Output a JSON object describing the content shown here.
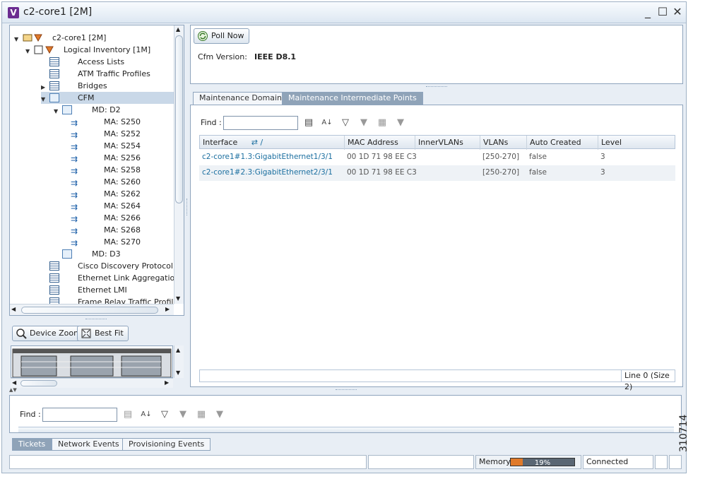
{
  "window": {
    "badge": "V",
    "title": "c2-core1 [2M]"
  },
  "tree": {
    "items": [
      {
        "label": "c2-core1 [2M]"
      },
      {
        "label": "Logical Inventory [1M]"
      },
      {
        "label": "Access Lists"
      },
      {
        "label": "ATM Traffic Profiles"
      },
      {
        "label": "Bridges"
      },
      {
        "label": "CFM"
      },
      {
        "label": "MD: D2"
      },
      {
        "label": "MA: S250"
      },
      {
        "label": "MA: S252"
      },
      {
        "label": "MA: S254"
      },
      {
        "label": "MA: S256"
      },
      {
        "label": "MA: S258"
      },
      {
        "label": "MA: S260"
      },
      {
        "label": "MA: S262"
      },
      {
        "label": "MA: S264"
      },
      {
        "label": "MA: S266"
      },
      {
        "label": "MA: S268"
      },
      {
        "label": "MA: S270"
      },
      {
        "label": "MD: D3"
      },
      {
        "label": "Cisco Discovery Protocol"
      },
      {
        "label": "Ethernet Link Aggregation"
      },
      {
        "label": "Ethernet LMI"
      },
      {
        "label": "Frame Relay Traffic Profiles"
      }
    ]
  },
  "zoom": {
    "device_zoom_label": "Device Zoom",
    "best_fit_label": "Best Fit"
  },
  "details": {
    "poll_now_label": "Poll Now",
    "cfm_version_label": "Cfm Version:",
    "cfm_version_value": "IEEE D8.1"
  },
  "tabs": [
    {
      "label": "Maintenance Domains",
      "active": false
    },
    {
      "label": "Maintenance Intermediate Points",
      "active": true
    }
  ],
  "mip_table": {
    "find_label": "Find :",
    "columns": [
      "Interface",
      "MAC Address",
      "InnerVLANs",
      "VLANs",
      "Auto Created",
      "Level"
    ],
    "rows": [
      {
        "interface": "c2-core1#1.3:GigabitEthernet1/3/1",
        "mac": "00 1D 71 98 EE C3",
        "inner_vlans": "",
        "vlans": "[250-270]",
        "auto_created": "false",
        "level": "3"
      },
      {
        "interface": "c2-core1#2.3:GigabitEthernet2/3/1",
        "mac": "00 1D 71 98 EE C3",
        "inner_vlans": "",
        "vlans": "[250-270]",
        "auto_created": "false",
        "level": "3"
      }
    ],
    "footer": "Line 0 (Size 2)"
  },
  "bottom": {
    "find_label": "Find :",
    "tabs": [
      "Tickets",
      "Network Events",
      "Provisioning Events"
    ]
  },
  "status": {
    "memory_label": "Memory:",
    "memory_percent": 19,
    "memory_text": "19%",
    "connection": "Connected"
  },
  "figure_id": "310714",
  "colors": {
    "link": "#1b6fa0",
    "accent": "#8fa3b8",
    "memory_fill": "#e07a2a"
  }
}
